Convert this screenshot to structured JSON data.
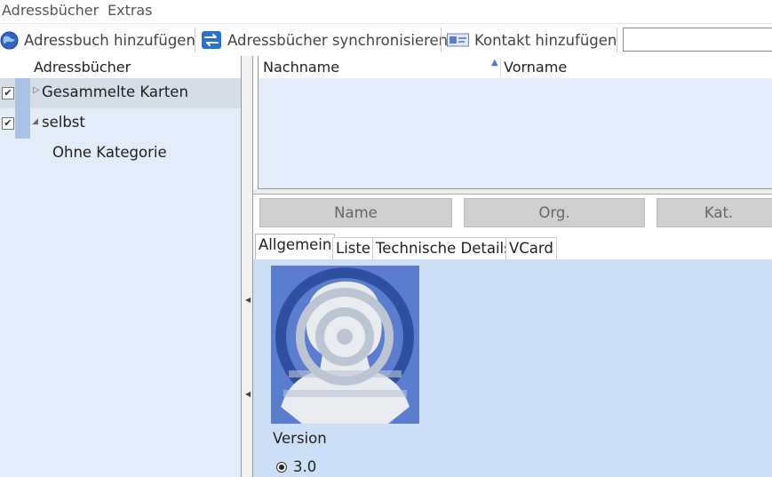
{
  "menu": [
    "Adressbücher",
    "Extras"
  ],
  "toolbar": {
    "add_addressbook": "Adressbuch hinzufügen",
    "sync": "Adressbücher synchronisieren",
    "add_contact": "Kontakt hinzufügen",
    "search_value": ""
  },
  "sidebar": {
    "header": "Adressbücher",
    "items": [
      {
        "label": "Gesammelte Karten",
        "checked": true,
        "expanded": false
      },
      {
        "label": "selbst",
        "checked": true,
        "expanded": true
      },
      {
        "label": "Ohne Kategorie"
      }
    ]
  },
  "contacts": {
    "columns": [
      "Nachname",
      "Vorname"
    ],
    "sort_indicator": "ascending"
  },
  "filters": [
    "Name",
    "Org.",
    "Kat."
  ],
  "tabs": [
    "Allgemein",
    "Liste",
    "Technische Details",
    "VCard"
  ],
  "details": {
    "version_label": "Version",
    "version_value": "3.0"
  },
  "colors": {
    "panel_bg": "#e3ecf9",
    "detail_bg": "#cddff7",
    "avatar_bg": "#5b7dcd",
    "avatar_ring": "#2f4fa0",
    "avatar_face": "#e8ebf0",
    "addressbook_color": "#a8c3e6"
  },
  "icons": {
    "add_addressbook": "globe-add-icon",
    "sync": "sync-arrows-icon",
    "add_contact": "contact-card-icon"
  }
}
